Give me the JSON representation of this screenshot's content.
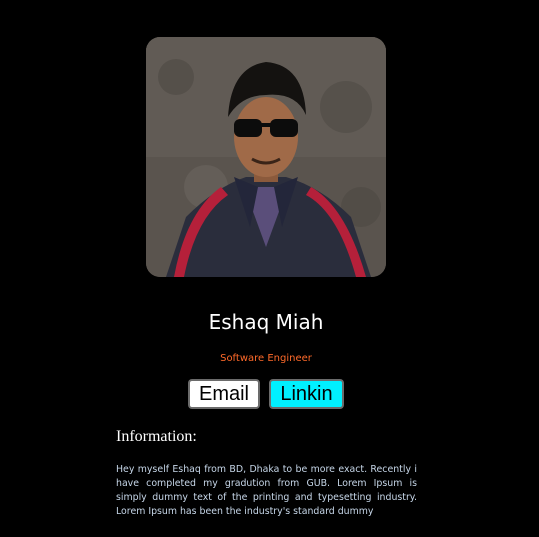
{
  "profile": {
    "name": "Eshaq Miah",
    "role": "Software Engineer",
    "photo_alt": "profile photo"
  },
  "buttons": {
    "email_label": "Email",
    "linkin_label": "Linkin"
  },
  "information": {
    "heading": "Information:",
    "text": "Hey myself Eshaq from BD, Dhaka to be more exact. Recently i have completed my gradution from GUB. Lorem Ipsum is simply dummy text of the printing and typesetting industry. Lorem Ipsum has been the industry's standard dummy"
  },
  "colors": {
    "background": "#000000",
    "name": "#ffffff",
    "role": "#ff6a2a",
    "email_button_bg": "#ffffff",
    "linkin_button_bg": "#00f0ff",
    "info_text": "#c6d6e8"
  }
}
